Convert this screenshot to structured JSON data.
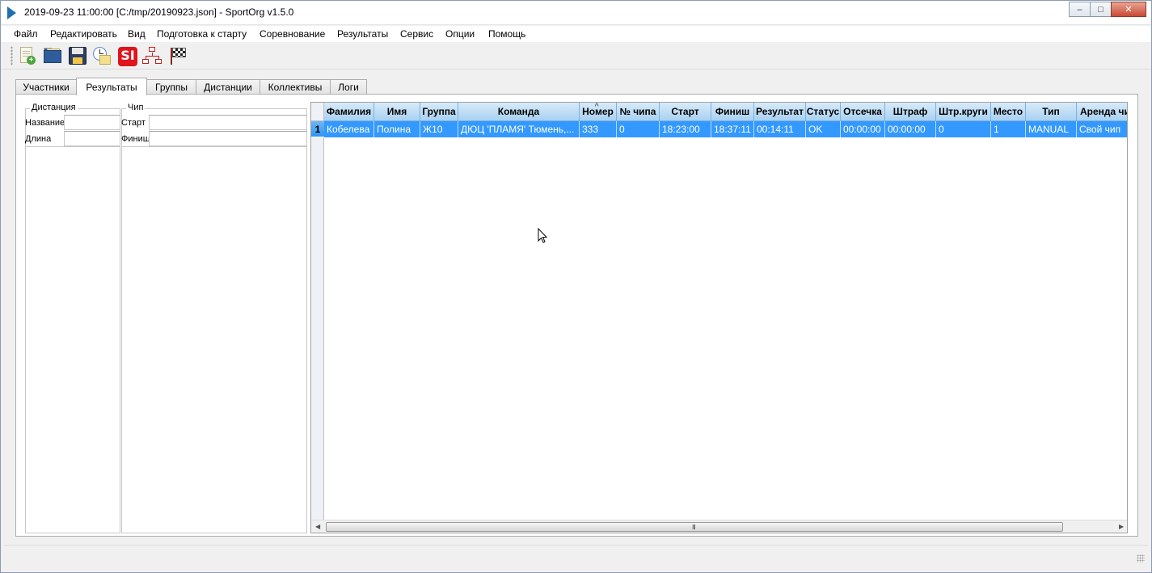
{
  "window": {
    "title": "2019-09-23 11:00:00 [C:/tmp/20190923.json] - SportOrg v1.5.0",
    "minimize_label": "–",
    "maximize_label": "□",
    "close_label": "✕"
  },
  "menu": [
    "Файл",
    "Редактировать",
    "Вид",
    "Подготовка к старту",
    "Соревнование",
    "Результаты",
    "Сервис",
    "Опции",
    "Помощь"
  ],
  "toolbar": {
    "icons": [
      "new-file-icon",
      "open-folder-icon",
      "save-icon",
      "clock-icon",
      "sportident-icon",
      "network-icon",
      "finish-flag-icon"
    ],
    "si_text": "SI"
  },
  "tabs": [
    "Участники",
    "Результаты",
    "Группы",
    "Дистанции",
    "Коллективы",
    "Логи"
  ],
  "active_tab": "Результаты",
  "info": {
    "course_title": "Дистанция",
    "course_name_label": "Название",
    "course_length_label": "Длина",
    "chip_title": "Чип",
    "chip_start_label": "Старт",
    "chip_finish_label": "Финиш"
  },
  "table": {
    "columns": [
      "Фамилия",
      "Имя",
      "Группа",
      "Команда",
      "Номер",
      "№ чипа",
      "Старт",
      "Финиш",
      "Результат",
      "Статус",
      "Отсечка",
      "Штраф",
      "Штр.круги",
      "Место",
      "Тип",
      "Аренда чипа"
    ],
    "sorted_column": "Номер",
    "rows": [
      {
        "index": "1",
        "cells": [
          "Кобелева",
          "Полина",
          "Ж10",
          "ДЮЦ 'ПЛАМЯ' Тюмень,...",
          "333",
          "0",
          "18:23:00",
          "18:37:11",
          "00:14:11",
          "OK",
          "00:00:00",
          "00:00:00",
          "0",
          "1",
          "MANUAL",
          "Свой чип"
        ]
      }
    ],
    "scroll_grip": "III"
  },
  "colors": {
    "selection": "#3399ff",
    "header_gradient_top": "#d7ebf9",
    "header_gradient_bottom": "#a9d1f1",
    "close_button": "#c94a33"
  }
}
